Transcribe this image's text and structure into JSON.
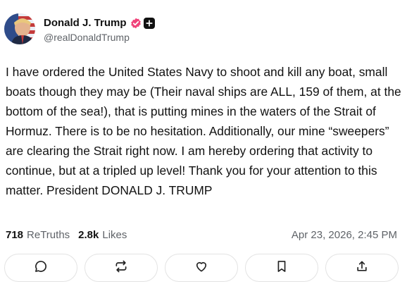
{
  "author": {
    "display_name": "Donald J. Trump",
    "handle": "@realDonaldTrump"
  },
  "post": {
    "text": "I have ordered the United States Navy to shoot and kill any boat, small boats though they may be (Their naval ships are ALL, 159 of them, at the bottom of the sea!), that is putting mines in the waters of the Strait of Hormuz. There is to be no hesitation. Additionally, our mine “sweepers” are clearing the Strait right now. I am hereby ordering that activity to continue, but at a tripled up level! Thank you for your attention to this matter. President DONALD J. TRUMP"
  },
  "stats": {
    "retruths_count": "718",
    "retruths_label": "ReTruths",
    "likes_count": "2.8k",
    "likes_label": "Likes",
    "timestamp": "Apr 23, 2026, 2:45 PM"
  },
  "icons": {
    "verified": "verified-badge-icon",
    "plus": "plus-badge-icon",
    "reply": "comment-icon",
    "retruth": "retruth-icon",
    "like": "heart-icon",
    "bookmark": "bookmark-icon",
    "share": "share-icon"
  },
  "colors": {
    "verified": "#f0437a",
    "text": "#111111",
    "muted": "#5f6368",
    "border": "#e3e3e3"
  }
}
